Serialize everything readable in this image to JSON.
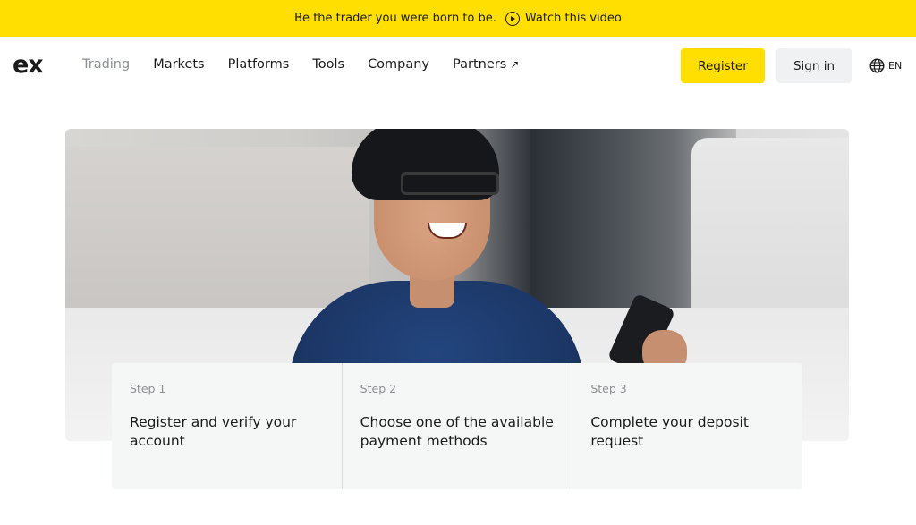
{
  "banner": {
    "text": "Be the trader you were born to be.",
    "link_label": "Watch this video"
  },
  "header": {
    "logo": "ex",
    "nav": [
      {
        "label": "Trading",
        "active": false,
        "dim": true
      },
      {
        "label": "Markets"
      },
      {
        "label": "Platforms"
      },
      {
        "label": "Tools"
      },
      {
        "label": "Company"
      },
      {
        "label": "Partners",
        "external": true
      }
    ],
    "register_label": "Register",
    "signin_label": "Sign in",
    "language": "EN"
  },
  "steps": [
    {
      "label": "Step 1",
      "text": "Register and verify your account"
    },
    {
      "label": "Step 2",
      "text": "Choose one of the available payment methods"
    },
    {
      "label": "Step 3",
      "text": "Complete your deposit request"
    }
  ],
  "colors": {
    "brand_yellow": "#ffde02",
    "text_dark": "#1b1b1b",
    "text_muted": "#8c8f94",
    "signin_bg": "#f0f1f2",
    "steps_bg": "#f5f6f6"
  }
}
